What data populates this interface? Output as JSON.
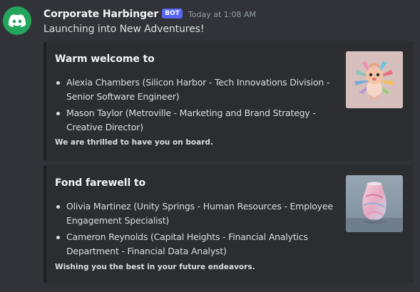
{
  "message": {
    "username": "Corporate Harbinger",
    "bot_tag": "BOT",
    "timestamp": "Today at 1:08 AM",
    "text": "Launching into New Adventures!",
    "avatar_icon": "discord-logo-icon"
  },
  "embeds": [
    {
      "title": "Warm welcome to",
      "items": [
        "Alexia Chambers (Silicon Harbor - Tech Innovations Division - Senior Software Engineer)",
        "Mason Taylor (Metroville - Marketing and Brand Strategy - Creative Director)"
      ],
      "footer": "We are thrilled to have you on board.",
      "thumbnail": "cartoon-lion-creature-image"
    },
    {
      "title": "Fond farewell to",
      "items": [
        "Olivia Martinez (Unity Springs - Human Resources - Employee Engagement Specialist)",
        "Cameron Reynolds (Capital Heights - Financial Analytics Department - Financial Data Analyst)"
      ],
      "footer": "Wishing you the best in your future endeavors.",
      "thumbnail": "marbled-vase-image"
    }
  ],
  "colors": {
    "background": "#313338",
    "embed_background": "#2b2d31",
    "avatar": "#23a55a",
    "bot_tag": "#5865f2"
  }
}
